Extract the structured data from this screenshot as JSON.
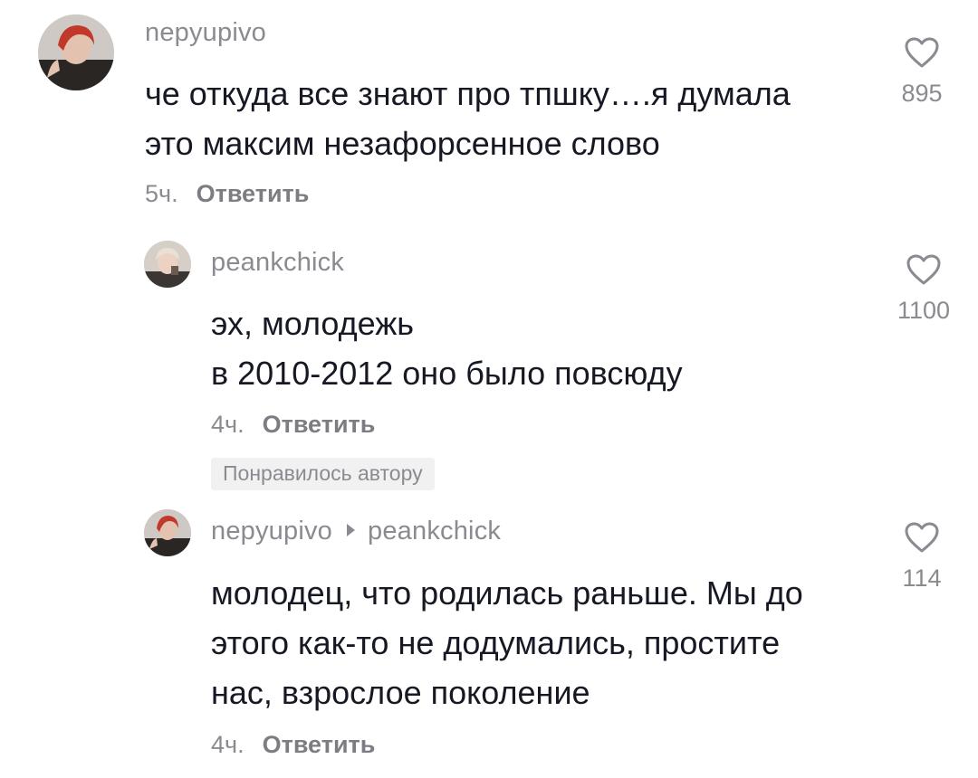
{
  "comments": [
    {
      "username": "nepyupivo",
      "lines": [
        "че откуда все знают про тпшку….я думала",
        "это максим незафорсенное слово"
      ],
      "time": "5ч.",
      "reply_label": "Ответить",
      "likes": "895"
    },
    {
      "username": "peankchick",
      "lines": [
        "эх, молодежь",
        "в 2010-2012 оно было повсюду"
      ],
      "time": "4ч.",
      "reply_label": "Ответить",
      "badge": "Понравилось автору",
      "likes": "1100"
    },
    {
      "username": "nepyupivo",
      "reply_to": "peankchick",
      "lines": [
        "молодец, что родилась раньше. Мы до",
        "этого как-то не додумались, простите",
        "нас, взрослое поколение"
      ],
      "time": "4ч.",
      "reply_label": "Ответить",
      "likes": "114"
    }
  ],
  "icons": {
    "like": "heart-outline-icon",
    "reply_arrow": "triangle-right-icon"
  },
  "colors": {
    "text": "#161823",
    "secondary": "#8a8b91",
    "badge_bg": "#f1f1f2"
  }
}
